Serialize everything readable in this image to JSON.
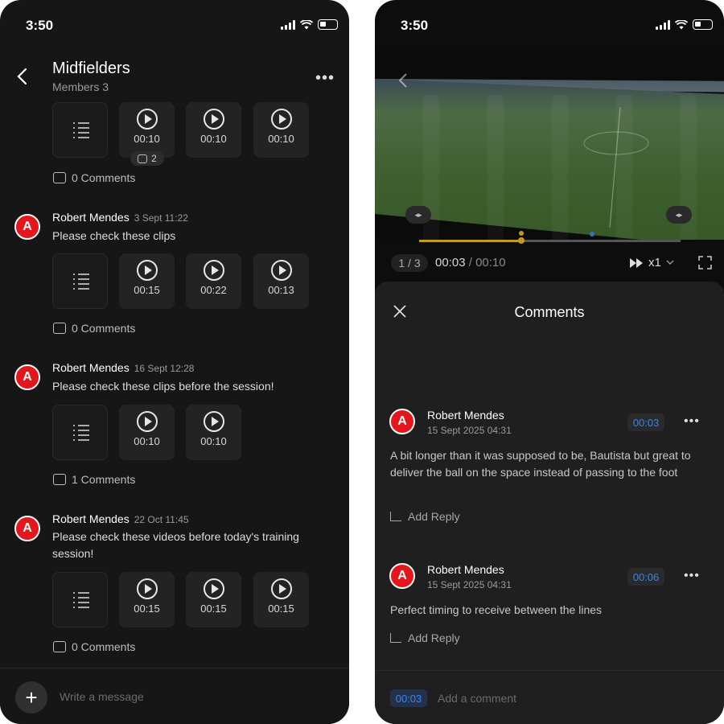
{
  "left": {
    "status_time": "3:50",
    "group_title": "Midfielders",
    "group_subtitle": "Members 3",
    "messages": [
      {
        "clips": [
          "00:10",
          "00:10",
          "00:10"
        ],
        "badge_count": "2",
        "comments": "0 Comments"
      },
      {
        "sender": "Robert Mendes",
        "time": "3 Sept 11:22",
        "text": "Please check these clips",
        "clips": [
          "00:15",
          "00:22",
          "00:13"
        ],
        "comments": "0 Comments"
      },
      {
        "sender": "Robert Mendes",
        "time": "16 Sept 12:28",
        "text": "Please check these clips before the session!",
        "clips": [
          "00:10",
          "00:10"
        ],
        "comments": "1 Comments"
      },
      {
        "sender": "Robert Mendes",
        "time": "22 Oct 11:45",
        "text": "Please check these videos before today's training session!",
        "clips": [
          "00:15",
          "00:15",
          "00:15"
        ],
        "comments": "0 Comments"
      }
    ],
    "avatar_letter": "A",
    "composer_placeholder": "Write a message"
  },
  "right": {
    "status_time": "3:50",
    "page_indicator": "1 / 3",
    "current_time": "00:03",
    "duration": "00:10",
    "time_separator": "/",
    "speed": "x1",
    "sheet_title": "Comments",
    "comments": [
      {
        "name": "Robert Mendes",
        "date": "15 Sept 2025 04:31",
        "timestamp": "00:03",
        "text": "A bit longer than it was supposed to be, Bautista but great to deliver the ball on the space instead of passing to the foot",
        "reply": "Add Reply"
      },
      {
        "name": "Robert Mendes",
        "date": "15 Sept 2025 04:31",
        "timestamp": "00:06",
        "text": "Perfect timing to receive between the lines",
        "reply": "Add Reply"
      }
    ],
    "composer_timestamp": "00:03",
    "composer_placeholder": "Add a comment"
  },
  "colors": {
    "accent_red": "#e2161b",
    "timestamp_blue": "#3b82f6",
    "scrub_gold": "#c49a18"
  },
  "icons": [
    "back-icon",
    "more-icon",
    "list-icon",
    "play-icon",
    "comment-icon",
    "plus-icon",
    "close-icon",
    "fast-forward-icon",
    "chevron-down-icon",
    "fullscreen-icon",
    "reply-arrow-icon",
    "signal-icon",
    "wifi-icon",
    "battery-icon"
  ]
}
